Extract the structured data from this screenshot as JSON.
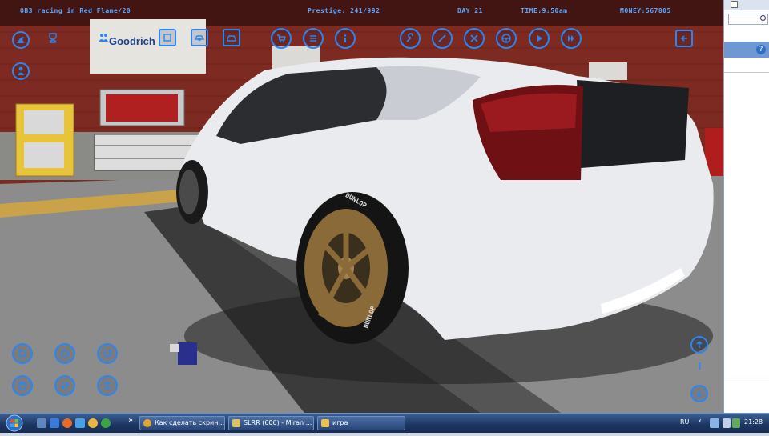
{
  "hud": {
    "car_name": "OB3 racing in Red Flame/20",
    "prestige": "Prestige: 241/992",
    "day": "DAY 21",
    "time": "TIME:9:50am",
    "money": "MONEY:567805"
  },
  "scene": {
    "banner_text": "Goodrich",
    "tire_brand": "DUNLOP",
    "tire_label": "DUNLOP"
  },
  "level_indicator": "I",
  "taskbar": {
    "items": [
      {
        "label": "Как сделать скрин..."
      },
      {
        "label": "SLRR (606) - Miran ..."
      },
      {
        "label": "игра"
      }
    ],
    "overflow": "»",
    "tray_lang": "RU",
    "tray_arrow": "‹",
    "clock": "21:28"
  },
  "side": {
    "help": "?"
  },
  "colors": {
    "hud_blue": "#5aa8ff",
    "button_blue": "#2d86ee",
    "car_white": "#e9ebee",
    "rim_bronze": "#8b6a3a"
  }
}
